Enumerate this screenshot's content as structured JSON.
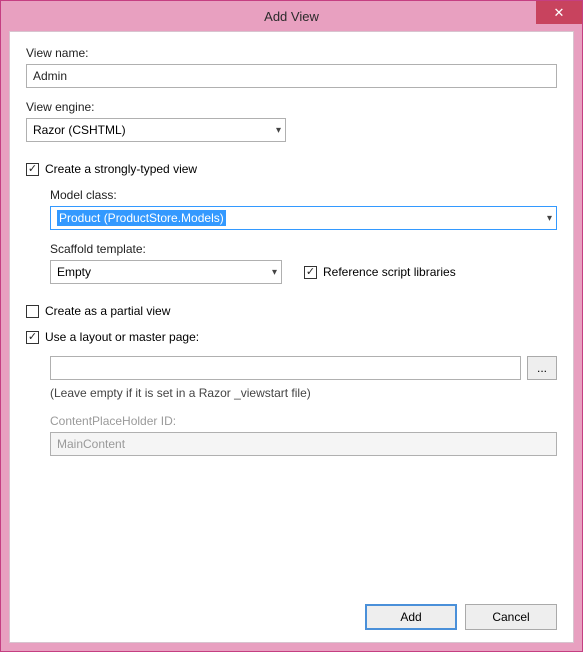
{
  "title": "Add View",
  "close_icon": "✕",
  "viewName": {
    "label": "View name:",
    "value": "Admin"
  },
  "viewEngine": {
    "label": "View engine:",
    "value": "Razor (CSHTML)"
  },
  "stronglyTyped": {
    "label": "Create a strongly-typed view",
    "checked": true
  },
  "modelClass": {
    "label": "Model class:",
    "value": "Product (ProductStore.Models)"
  },
  "scaffold": {
    "label": "Scaffold template:",
    "value": "Empty"
  },
  "refScript": {
    "label": "Reference script libraries",
    "checked": true
  },
  "partial": {
    "label": "Create as a partial view",
    "checked": false
  },
  "layout": {
    "label": "Use a layout or master page:",
    "checked": true,
    "value": "",
    "browse": "...",
    "hint": "(Leave empty if it is set in a Razor _viewstart file)"
  },
  "placeholder": {
    "label": "ContentPlaceHolder ID:",
    "value": "MainContent"
  },
  "buttons": {
    "add": "Add",
    "cancel": "Cancel"
  }
}
